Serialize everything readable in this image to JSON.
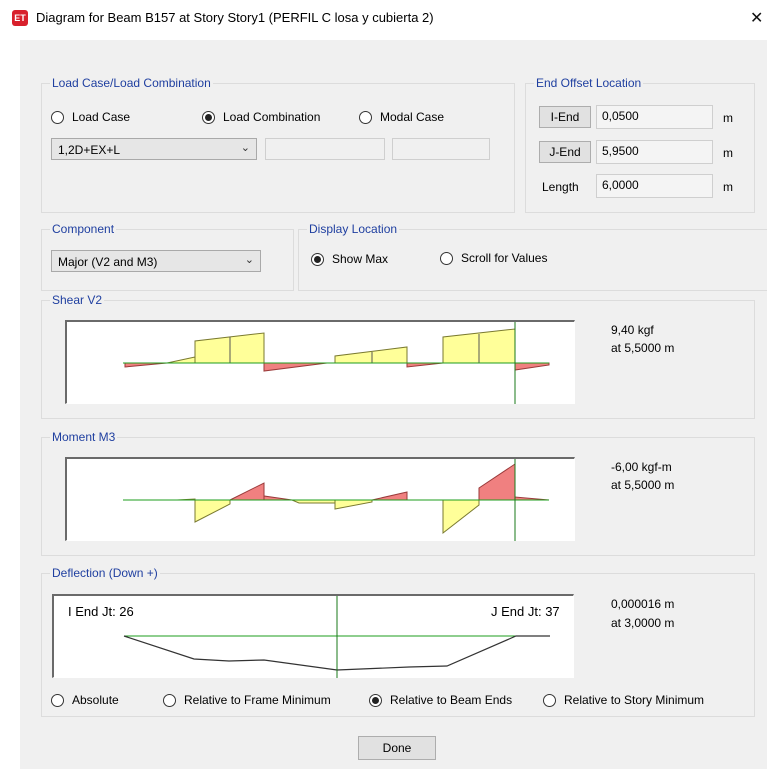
{
  "window": {
    "title": "Diagram for Beam B157 at Story Story1 (PERFIL C losa y cubierta 2)",
    "icon_text": "ET",
    "close_glyph": "✕"
  },
  "load_case": {
    "group_label": "Load Case/Load Combination",
    "radio_load_case": "Load Case",
    "radio_load_combination": "Load Combination",
    "radio_modal_case": "Modal Case",
    "selected_radio": "Load Combination",
    "combo_value": "1,2D+EX+L"
  },
  "end_offset": {
    "group_label": "End Offset Location",
    "i_end_button": "I-End",
    "i_end_value": "0,0500",
    "j_end_button": "J-End",
    "j_end_value": "5,9500",
    "length_label": "Length",
    "length_value": "6,0000",
    "unit": "m"
  },
  "component": {
    "group_label": "Component",
    "combo_value": "Major (V2 and M3)"
  },
  "display_location": {
    "group_label": "Display Location",
    "show_max": "Show Max",
    "scroll_values": "Scroll for Values",
    "selected": "Show Max"
  },
  "shear": {
    "group_label": "Shear V2",
    "value": "9,40 kgf",
    "location": "at 5,5000 m"
  },
  "moment": {
    "group_label": "Moment M3",
    "value": "-6,00 kgf-m",
    "location": "at 5,5000 m"
  },
  "deflection": {
    "group_label": "Deflection (Down +)",
    "i_end_label": "I End Jt: 26",
    "j_end_label": "J End Jt: 37",
    "value": "0,000016 m",
    "location": "at 3,0000 m",
    "radio_absolute": "Absolute",
    "radio_relative_frame": "Relative to Frame Minimum",
    "radio_relative_beam": "Relative to Beam Ends",
    "radio_relative_story": "Relative to Story Minimum",
    "selected": "Relative to Beam Ends"
  },
  "done_button": "Done",
  "colors": {
    "positive_fill": "#ffff99",
    "negative_fill": "#f08080",
    "axis_line": "#1e9e1e",
    "label_blue": "#1f3fa0",
    "marker_line": "#1a7a1a"
  }
}
